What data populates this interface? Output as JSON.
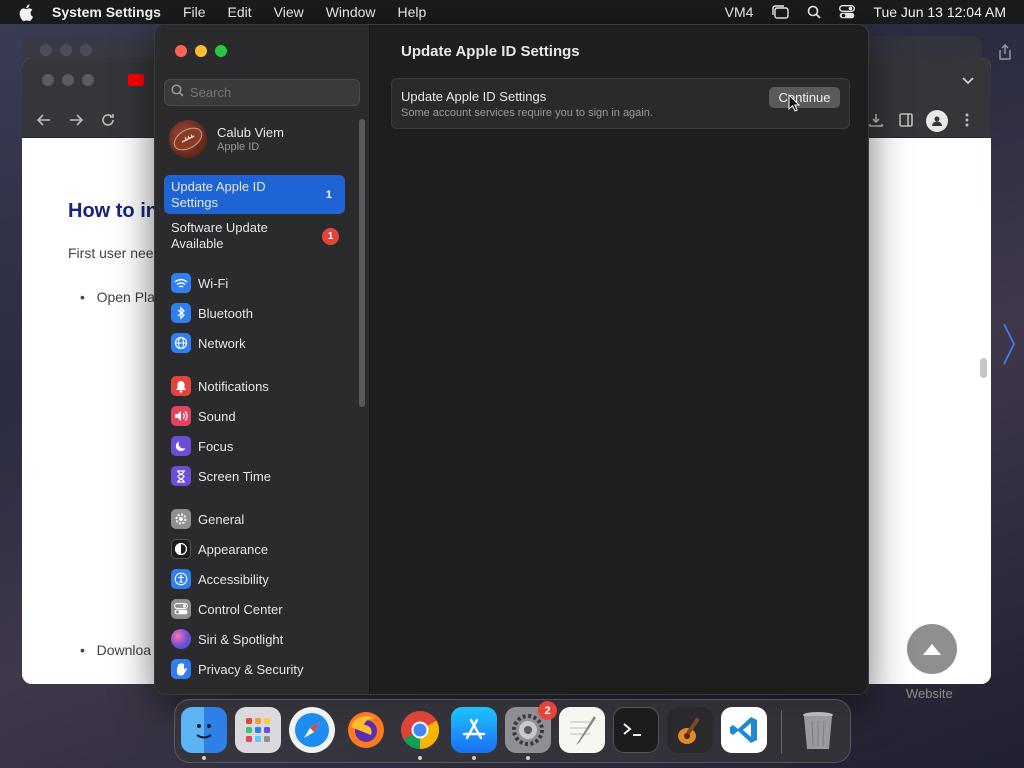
{
  "menubar": {
    "app_name": "System Settings",
    "menus": [
      "File",
      "Edit",
      "View",
      "Window",
      "Help"
    ],
    "status_text": "VM4",
    "datetime": "Tue Jun 13  12:04 AM"
  },
  "background_browser": {
    "heading_fragment": "How to in",
    "paragraph_fragment": "First user nee",
    "bullet_1_fragment": "Open Pla",
    "bullet_2_fragment": "Downloa",
    "footer_fragment": "Website"
  },
  "settings": {
    "search": {
      "placeholder": "Search"
    },
    "account": {
      "name": "Calub Viem",
      "subtitle": "Apple ID"
    },
    "alerts": [
      {
        "label": "Update Apple ID Settings",
        "count": "1",
        "selected": true
      },
      {
        "label": "Software Update Available",
        "count": "1",
        "selected": false
      }
    ],
    "sidebar_items": [
      {
        "label": "Wi-Fi",
        "icon": "wifi-icon",
        "color": "#2f7ff0"
      },
      {
        "label": "Bluetooth",
        "icon": "bluetooth-icon",
        "color": "#2f7ff0"
      },
      {
        "label": "Network",
        "icon": "network-globe-icon",
        "color": "#2f7ff0"
      },
      {
        "label": "Notifications",
        "icon": "notifications-bell-icon",
        "color": "#e5443b"
      },
      {
        "label": "Sound",
        "icon": "sound-speaker-icon",
        "color": "#e5445e"
      },
      {
        "label": "Focus",
        "icon": "focus-moon-icon",
        "color": "#6a4fd6"
      },
      {
        "label": "Screen Time",
        "icon": "screen-time-hourglass-icon",
        "color": "#6a4fd6"
      },
      {
        "label": "General",
        "icon": "general-gear-icon",
        "color": "#8e8e93"
      },
      {
        "label": "Appearance",
        "icon": "appearance-icon",
        "color": "#1c1c1e"
      },
      {
        "label": "Accessibility",
        "icon": "accessibility-icon",
        "color": "#2f7ff0"
      },
      {
        "label": "Control Center",
        "icon": "control-center-icon",
        "color": "#8e8e93"
      },
      {
        "label": "Siri & Spotlight",
        "icon": "siri-icon",
        "color": "#9b59d0"
      },
      {
        "label": "Privacy & Security",
        "icon": "privacy-hand-icon",
        "color": "#2f7ff0"
      }
    ],
    "main": {
      "title": "Update Apple ID Settings",
      "card_title": "Update Apple ID Settings",
      "card_description": "Some account services require you to sign in again.",
      "continue_label": "Continue"
    }
  },
  "dock": {
    "apps": [
      {
        "name": "Finder",
        "icon": "finder-icon",
        "running": true
      },
      {
        "name": "Launchpad",
        "icon": "launchpad-icon",
        "running": false
      },
      {
        "name": "Safari",
        "icon": "safari-icon",
        "running": false
      },
      {
        "name": "Firefox",
        "icon": "firefox-icon",
        "running": false
      },
      {
        "name": "Chrome",
        "icon": "chrome-icon",
        "running": true
      },
      {
        "name": "App Store",
        "icon": "app-store-icon",
        "running": true
      },
      {
        "name": "System Settings",
        "icon": "system-settings-icon",
        "running": true,
        "badge": "2"
      },
      {
        "name": "TextEdit",
        "icon": "textedit-icon",
        "running": false
      },
      {
        "name": "Terminal",
        "icon": "terminal-icon",
        "running": false
      },
      {
        "name": "GarageBand",
        "icon": "garageband-icon",
        "running": false
      },
      {
        "name": "Visual Studio Code",
        "icon": "vscode-icon",
        "running": false
      },
      {
        "name": "Trash",
        "icon": "trash-icon",
        "running": false
      }
    ]
  }
}
